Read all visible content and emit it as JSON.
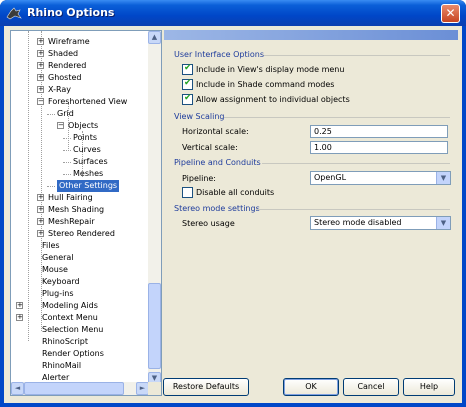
{
  "window": {
    "title": "Rhino Options",
    "close_glyph": "✕",
    "icon": "rhino-logo-icon"
  },
  "tree": {
    "items": [
      {
        "label": "Wireframe",
        "expander": "+"
      },
      {
        "label": "Shaded",
        "expander": "+"
      },
      {
        "label": "Rendered",
        "expander": "+"
      },
      {
        "label": "Ghosted",
        "expander": "+"
      },
      {
        "label": "X-Ray",
        "expander": "+"
      },
      {
        "label": "Foreshortened View",
        "expander": "−"
      },
      {
        "label": "Grid",
        "expander": ""
      },
      {
        "label": "Objects",
        "expander": "−"
      },
      {
        "label": "Points",
        "expander": ""
      },
      {
        "label": "Curves",
        "expander": ""
      },
      {
        "label": "Surfaces",
        "expander": ""
      },
      {
        "label": "Meshes",
        "expander": ""
      },
      {
        "label": "Other Settings",
        "expander": "",
        "selected": true
      },
      {
        "label": "Hull Fairing",
        "expander": "+"
      },
      {
        "label": "Mesh Shading",
        "expander": "+"
      },
      {
        "label": "MeshRepair",
        "expander": "+"
      },
      {
        "label": "Stereo Rendered",
        "expander": "+"
      },
      {
        "label": "Files",
        "expander": ""
      },
      {
        "label": "General",
        "expander": ""
      },
      {
        "label": "Mouse",
        "expander": ""
      },
      {
        "label": "Keyboard",
        "expander": ""
      },
      {
        "label": "Plug-ins",
        "expander": ""
      },
      {
        "label": "Modeling Aids",
        "expander": "+"
      },
      {
        "label": "Context Menu",
        "expander": "+"
      },
      {
        "label": "Selection Menu",
        "expander": ""
      },
      {
        "label": "RhinoScript",
        "expander": ""
      },
      {
        "label": "Render Options",
        "expander": ""
      },
      {
        "label": "RhinoMail",
        "expander": ""
      },
      {
        "label": "Alerter",
        "expander": ""
      }
    ],
    "scroll_up": "▲",
    "scroll_down": "▼",
    "scroll_left": "◄",
    "scroll_right": "►"
  },
  "ui_options": {
    "header": "User Interface Options",
    "checks": [
      {
        "label": "Include in View's display mode menu",
        "checked": true
      },
      {
        "label": "Include in Shade command modes",
        "checked": true
      },
      {
        "label": "Allow assignment to individual objects",
        "checked": true
      }
    ],
    "check_glyph": "✔"
  },
  "view_scaling": {
    "header": "View Scaling",
    "horizontal_label": "Horizontal scale:",
    "horizontal_value": "0.25",
    "vertical_label": "Vertical scale:",
    "vertical_value": "1.00"
  },
  "pipeline": {
    "header": "Pipeline and Conduits",
    "pipeline_label": "Pipeline:",
    "pipeline_value": "OpenGL",
    "disable_label": "Disable all conduits",
    "disable_checked": false
  },
  "stereo": {
    "header": "Stereo mode settings",
    "usage_label": "Stereo usage",
    "usage_value": "Stereo mode disabled"
  },
  "combo_arrow": "▼",
  "buttons": {
    "restore": "Restore Defaults",
    "ok": "OK",
    "cancel": "Cancel",
    "help": "Help"
  }
}
